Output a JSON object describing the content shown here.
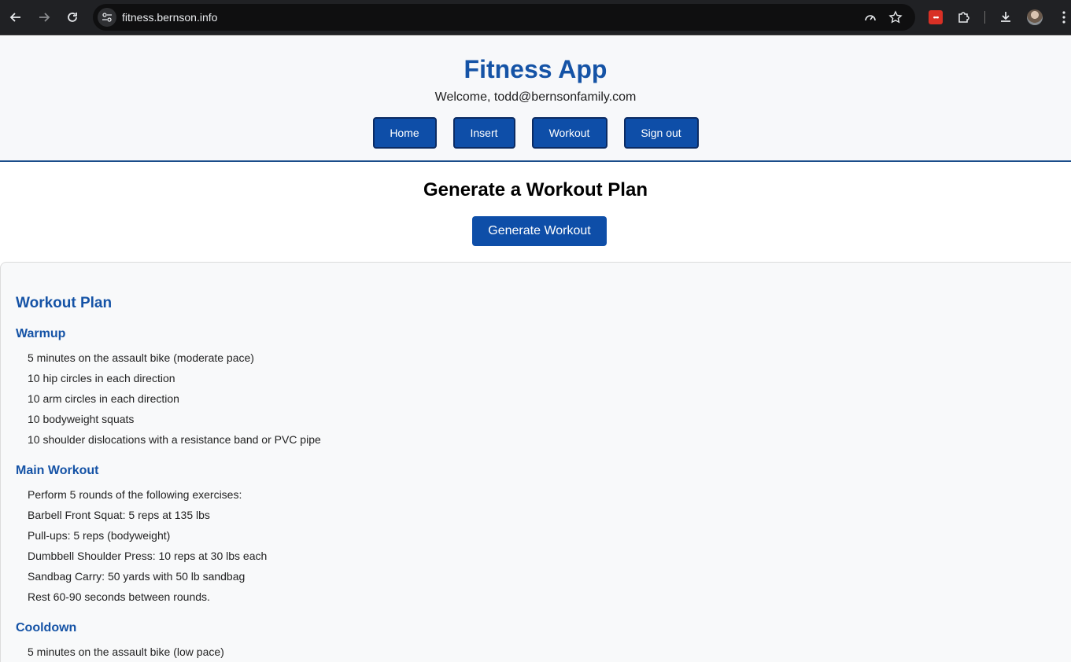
{
  "browser": {
    "url": "fitness.bernson.info",
    "icons": [
      "back-icon",
      "forward-icon",
      "reload-icon",
      "site-settings-icon",
      "performance-icon",
      "star-icon",
      "extension-icon",
      "extensions-puzzle-icon",
      "download-icon",
      "profile-avatar",
      "more-menu-icon"
    ],
    "ext_red_label": "•••"
  },
  "header": {
    "title": "Fitness App",
    "welcome": "Welcome, todd@bernsonfamily.com",
    "nav": [
      "Home",
      "Insert",
      "Workout",
      "Sign out"
    ]
  },
  "generate": {
    "title": "Generate a Workout Plan",
    "button": "Generate Workout"
  },
  "plan": {
    "title": "Workout Plan",
    "warmup": {
      "title": "Warmup",
      "items": [
        "5 minutes on the assault bike (moderate pace)",
        "10 hip circles in each direction",
        "10 arm circles in each direction",
        "10 bodyweight squats",
        "10 shoulder dislocations with a resistance band or PVC pipe"
      ]
    },
    "main": {
      "title": "Main Workout",
      "items": [
        "Perform 5 rounds of the following exercises:",
        "Barbell Front Squat: 5 reps at 135 lbs",
        "Pull-ups: 5 reps (bodyweight)",
        "Dumbbell Shoulder Press: 10 reps at 30 lbs each",
        "Sandbag Carry: 50 yards with 50 lb sandbag",
        "Rest 60-90 seconds between rounds."
      ]
    },
    "cooldown": {
      "title": "Cooldown",
      "items": [
        "5 minutes on the assault bike (low pace)"
      ]
    }
  },
  "colors": {
    "accent": "#1553a6",
    "button": "#0e4ea8",
    "chrome": "#202124"
  }
}
